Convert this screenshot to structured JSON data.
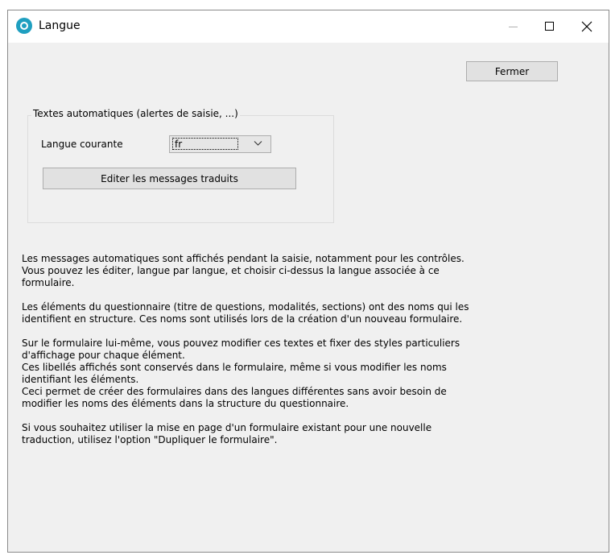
{
  "window": {
    "title": "Langue"
  },
  "toolbar": {
    "close_label": "Fermer"
  },
  "group": {
    "legend": "Textes automatiques (alertes de saisie, ...)",
    "language_label": "Langue courante",
    "language_value": "fr",
    "edit_button": "Editer les messages traduits"
  },
  "info": {
    "p1": "Les messages automatiques sont affichés pendant la saisie, notamment pour les contrôles.\nVous pouvez les éditer, langue par langue, et choisir ci-dessus la langue associée à ce\nformulaire.",
    "p2": "Les éléments du questionnaire (titre de questions, modalités, sections) ont des noms qui les\nidentifient en structure. Ces noms sont utilisés lors de la création d'un nouveau formulaire.",
    "p3": "Sur le formulaire lui-même, vous pouvez modifier ces textes et fixer des styles particuliers\nd'affichage pour chaque élément.\nCes libellés affichés sont conservés dans le formulaire, même si vous modifier les noms\nidentifiant les éléments.\nCeci permet de créer des formulaires dans des langues différentes sans avoir besoin de\nmodifier les noms des éléments dans la structure du questionnaire.",
    "p4": "Si vous souhaitez utiliser la mise en page d'un formulaire existant pour une nouvelle\ntraduction, utilisez l'option \"Dupliquer le formulaire\"."
  },
  "icons": {
    "app": "app-icon",
    "minimize": "minimize-icon",
    "maximize": "maximize-icon",
    "close": "close-icon",
    "dropdown": "chevron-down-icon"
  },
  "colors": {
    "app_icon": "#1f9fc0",
    "window_bg": "#f0f0f0",
    "button_bg": "#e1e1e1"
  }
}
